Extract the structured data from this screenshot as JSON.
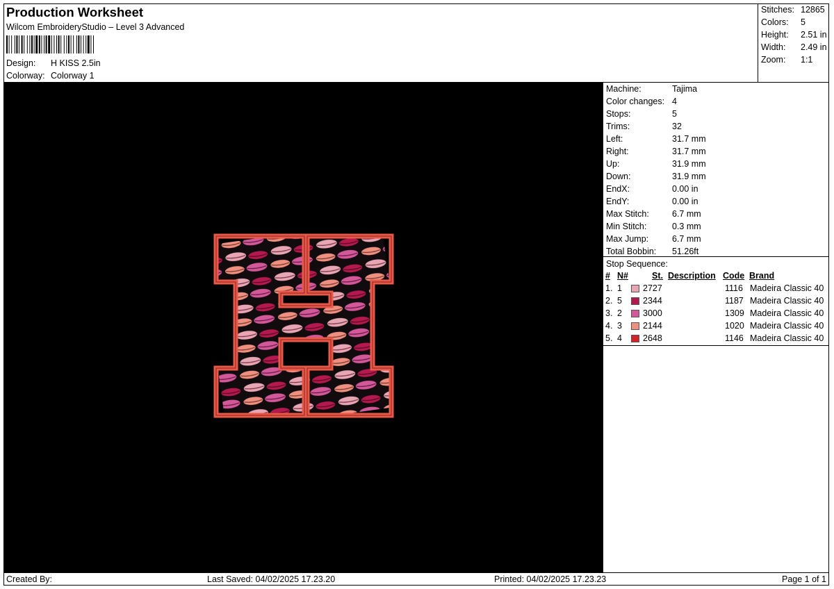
{
  "header": {
    "title": "Production Worksheet",
    "software": "Wilcom EmbroideryStudio – Level 3 Advanced",
    "design_label": "Design:",
    "design_value": "H KISS 2.5in",
    "colorway_label": "Colorway:",
    "colorway_value": "Colorway 1"
  },
  "summary": {
    "stitches_label": "Stitches:",
    "stitches_value": "12865",
    "colors_label": "Colors:",
    "colors_value": "5",
    "height_label": "Height:",
    "height_value": "2.51 in",
    "width_label": "Width:",
    "width_value": "2.49 in",
    "zoom_label": "Zoom:",
    "zoom_value": "1:1"
  },
  "machine_info": [
    {
      "label": "Machine:",
      "value": "Tajima"
    },
    {
      "label": "Color changes:",
      "value": "4"
    },
    {
      "label": "Stops:",
      "value": "5"
    },
    {
      "label": "Trims:",
      "value": "32"
    },
    {
      "label": "Left:",
      "value": "31.7 mm"
    },
    {
      "label": "Right:",
      "value": "31.7 mm"
    },
    {
      "label": "Up:",
      "value": "31.9 mm"
    },
    {
      "label": "Down:",
      "value": "31.9 mm"
    },
    {
      "label": "EndX:",
      "value": "0.00 in"
    },
    {
      "label": "EndY:",
      "value": "0.00 in"
    },
    {
      "label": "Max Stitch:",
      "value": "6.7 mm"
    },
    {
      "label": "Min Stitch:",
      "value": "0.3 mm"
    },
    {
      "label": "Max Jump:",
      "value": "6.7 mm"
    },
    {
      "label": "Total Bobbin:",
      "value": "51.26ft"
    }
  ],
  "stop_sequence": {
    "title": "Stop Sequence:",
    "columns": {
      "idx": "#",
      "n": "N#",
      "st": "St.",
      "description": "Description",
      "code": "Code",
      "brand": "Brand"
    },
    "rows": [
      {
        "idx": "1.",
        "n": "1",
        "color": "#e8a6b4",
        "st": "2727",
        "code": "1116",
        "brand": "Madeira Classic 40"
      },
      {
        "idx": "2.",
        "n": "5",
        "color": "#b3184f",
        "st": "2344",
        "code": "1187",
        "brand": "Madeira Classic 40"
      },
      {
        "idx": "3.",
        "n": "2",
        "color": "#d2589a",
        "st": "3000",
        "code": "1309",
        "brand": "Madeira Classic 40"
      },
      {
        "idx": "4.",
        "n": "3",
        "color": "#ee8f80",
        "st": "2144",
        "code": "1020",
        "brand": "Madeira Classic 40"
      },
      {
        "idx": "5.",
        "n": "4",
        "color": "#d5222a",
        "st": "2648",
        "code": "1146",
        "brand": "Madeira Classic 40"
      }
    ]
  },
  "footer": {
    "created_by": "Created By:",
    "last_saved": "Last Saved: 04/02/2025 17.23.20",
    "printed": "Printed: 04/02/2025 17.23.23",
    "page": "Page 1 of 1"
  },
  "design_preview": {
    "icon": "embroidered-letter-h-kiss-pattern",
    "background_color": "#000000",
    "outline_color": "#e9594a"
  }
}
